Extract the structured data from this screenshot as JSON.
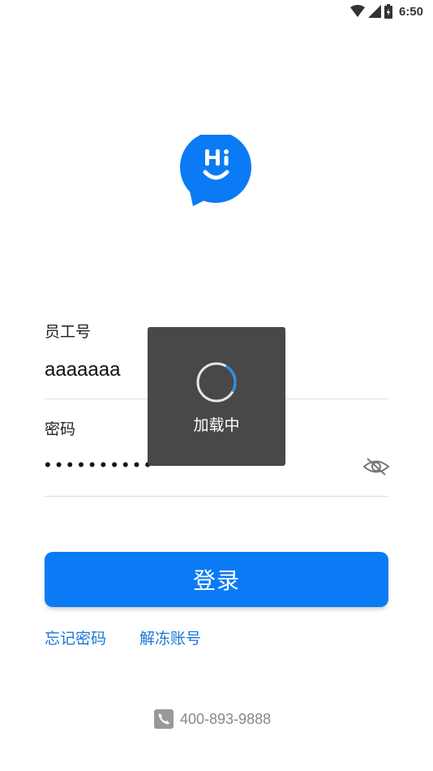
{
  "status_bar": {
    "time": "6:50"
  },
  "form": {
    "employee_label": "员工号",
    "employee_value": "aaaaaaa",
    "password_label": "密码",
    "password_value": "••••••••••"
  },
  "login_button": "登录",
  "links": {
    "forgot_password": "忘记密码",
    "unfreeze_account": "解冻账号"
  },
  "hotline": "400-893-9888",
  "loading": {
    "text": "加载中"
  },
  "colors": {
    "primary": "#0a7bf5",
    "link": "#1b76d6",
    "overlay": "#444444"
  }
}
